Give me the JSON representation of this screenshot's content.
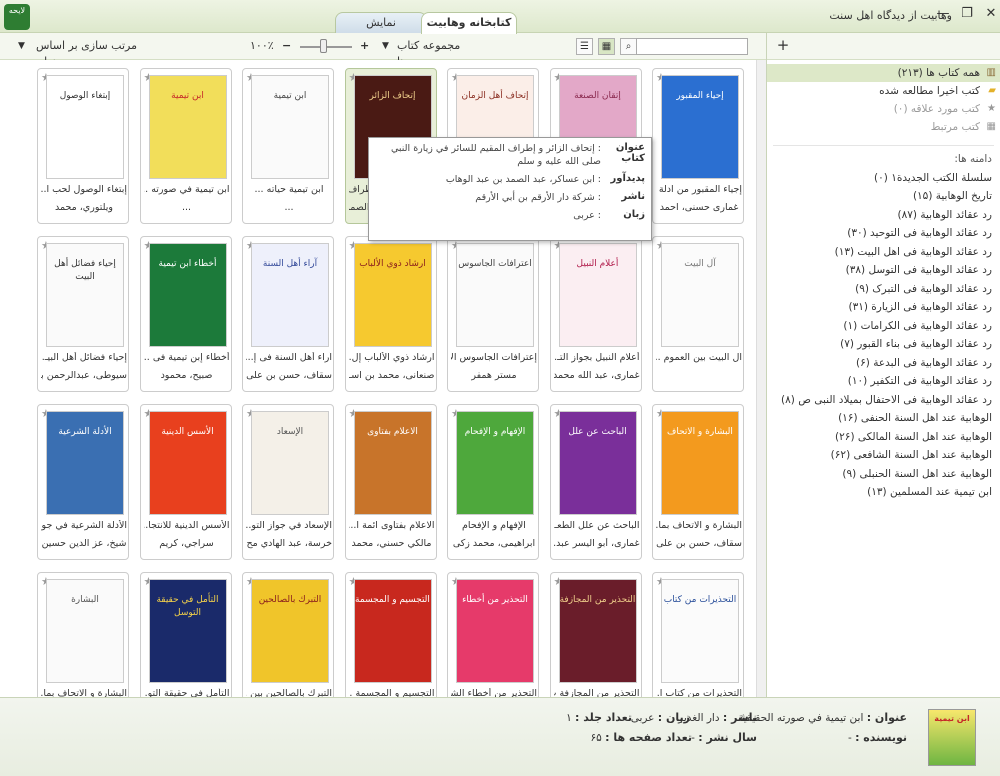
{
  "window": {
    "title": "وهابيت از ديدگاه اهل سنت",
    "logo_text": "لايحه",
    "close": "✕",
    "restore": "❐",
    "minimize": "—"
  },
  "tabs": [
    {
      "label": "کتابخانه وهابيت"
    },
    {
      "label": "نمايش"
    }
  ],
  "toolbar": {
    "collection_label": "مجموعه کتاب ها",
    "zoom": "۱۰۰٪",
    "zoom_minus": "−",
    "zoom_plus": "+",
    "sort_label": "مرتب سازی بر اساس زبان",
    "search_value": ""
  },
  "books": [
    {
      "title": "إجياء المقبور من ادلة ...",
      "author": "غماری حسنی، احمد",
      "cover": "إحياء المقبور",
      "bg": "#2b6fd1",
      "fg": "#fff"
    },
    {
      "title": "اتقان الصنعة في تحقي...",
      "author": "غماری، عبد الله محمد...",
      "cover": "إتقان الصنعة",
      "bg": "#e3a8c8",
      "fg": "#8b2b50"
    },
    {
      "title": "إتحاف أهل الزمان بأ...",
      "author": "ابن‌ابی‌ضیاف، احمد",
      "cover": "إتحاف أهل الزمان",
      "bg": "#fbeee8",
      "fg": "#8a2e22"
    },
    {
      "title": "إتحاف الزائر و إطراف...",
      "author": "ابن عساكر، عبد الصمد...",
      "cover": "إتحاف الزائر",
      "bg": "#4a1a14",
      "fg": "#f0d08c"
    },
    {
      "title": "ابن تيمية حياته ...",
      "author": "...",
      "cover": "ابن تيمية",
      "bg": "#fafafa",
      "fg": "#444"
    },
    {
      "title": "ابن تيمية في صورته ...",
      "author": "...",
      "cover": "ابن تيمية",
      "bg": "#f2de5a",
      "fg": "#c62828"
    },
    {
      "title": "إبتغاء الوصول لحب ا...",
      "author": "ويلتوري، محمد",
      "cover": "إبتغاء الوصول",
      "bg": "#fff",
      "fg": "#333"
    },
    {
      "title": "آل البيت بين العموم ...",
      "author": "",
      "cover": "آل البيت",
      "bg": "#fbfbfb",
      "fg": "#777"
    },
    {
      "title": "أعلام النبيل بجواز التـ...",
      "author": "غماری، عبد الله محمد...",
      "cover": "أعلام النبيل",
      "bg": "#fbeef2",
      "fg": "#b01a4a"
    },
    {
      "title": "إعترافات الجاسوس الا...",
      "author": "مستر همفر",
      "cover": "اعترافات الجاسوس",
      "bg": "#fafafa",
      "fg": "#444"
    },
    {
      "title": "ارشاد ذوي الألباب إل...",
      "author": "صنعانی، محمد بن اسـ...",
      "cover": "ارشاد ذوي الألباب",
      "bg": "#f6c92f",
      "fg": "#8a1d1d"
    },
    {
      "title": "آراء أهل السنة فى إ...",
      "author": "سقاف، حسن بن علی",
      "cover": "آراء أهل السنة",
      "bg": "#eef0fb",
      "fg": "#344a9a"
    },
    {
      "title": "أخطاء إبن تيمية فى ...",
      "author": "صبيح، محمود",
      "cover": "أخطاء ابن تيمية",
      "bg": "#1c7a3a",
      "fg": "#fff"
    },
    {
      "title": "إحياء فضائل أهل البيـ...",
      "author": "سيوطی، عبدالرحمن بـ...",
      "cover": "إحياء فضائل أهل البيت",
      "bg": "#fafafa",
      "fg": "#333"
    },
    {
      "title": "البشارة و الاتحاف بما...",
      "author": "سقاف، حسن بن علی",
      "cover": "البشارة و الاتحاف",
      "bg": "#f39a1e",
      "fg": "#fff"
    },
    {
      "title": "الباحث عن علل الطعـ...",
      "author": "غماری، أبو اليسر عبد...",
      "cover": "الباحث عن علل",
      "bg": "#7a2f9a",
      "fg": "#fff"
    },
    {
      "title": "الإفهام و الإفحام",
      "author": "ابراهیمی، محمد زکی",
      "cover": "الإفهام و الإفحام",
      "bg": "#4ea83c",
      "fg": "#fff"
    },
    {
      "title": "الاعلام بفتاوى ائمة ا...",
      "author": "مالكي حسني، محمد",
      "cover": "الاعلام بفتاوى",
      "bg": "#c8742a",
      "fg": "#fff"
    },
    {
      "title": "الإسعاد في جواز التو...",
      "author": "خرسة، عبد الهادي مح...",
      "cover": "الإسعاد",
      "bg": "#f4f0e8",
      "fg": "#555"
    },
    {
      "title": "الأسس الدينية للانتجا...",
      "author": "سراجي، کريم",
      "cover": "الأسس الدينية",
      "bg": "#e8401e",
      "fg": "#fff"
    },
    {
      "title": "الأدلة الشرعية في جوا...",
      "author": "شيخ، عز الدين حسين",
      "cover": "الأدلة الشرعية",
      "bg": "#3a6fb2",
      "fg": "#fff"
    },
    {
      "title": "التحذيرات من كتاب ا...",
      "author": "",
      "cover": "التحذيرات من كتاب",
      "bg": "#fbfbfb",
      "fg": "#2a4f9a"
    },
    {
      "title": "التحذير من المجازفة ب...",
      "author": "",
      "cover": "التحذير من المجازفة",
      "bg": "#6a1d2a",
      "fg": "#f0d08c"
    },
    {
      "title": "التحذير من أخطاء الشـ...",
      "author": "",
      "cover": "التحذير من أخطاء",
      "bg": "#e63a6a",
      "fg": "#fff"
    },
    {
      "title": "التجسيم و المجسمة ...",
      "author": "",
      "cover": "التجسيم و المجسمة",
      "bg": "#c8281e",
      "fg": "#fff"
    },
    {
      "title": "التبرك بالصالحين بين ...",
      "author": "",
      "cover": "التبرك بالصالحين",
      "bg": "#f0c52a",
      "fg": "#8a1d1d"
    },
    {
      "title": "التأمل في حقيقة التو...",
      "author": "",
      "cover": "التأمل في حقيقة التوسل",
      "bg": "#1a2a6a",
      "fg": "#f6d34a"
    },
    {
      "title": "البشارة و الاتحاف بما...",
      "author": "",
      "cover": "البشارة",
      "bg": "#fafafa",
      "fg": "#555"
    }
  ],
  "tooltip": {
    "title_label": "عنوان كتاب",
    "title_value": ": إتحاف الزائر و إطراف المقيم للسائر في زيارة النبي صلى الله عليه و سلم",
    "author_label": "پديدآور",
    "author_value": ": ابن عساكر، عبد الصمد بن عبد الوهاب",
    "publisher_label": "ناشر",
    "publisher_value": ": شركة دار الأرقم بن أبي الأرقم",
    "lang_label": "زبان",
    "lang_value": ": عربی"
  },
  "sidebar": {
    "add": "+",
    "items": [
      {
        "label": "همه کتاب ها (۲۱۳)",
        "icon": "books-icon"
      },
      {
        "label": "کتب اخیرا مطالعه شده",
        "icon": "folder-icon"
      },
      {
        "label": "کتب مورد علاقه (۰)",
        "icon": "star-icon"
      },
      {
        "label": "کتب مرتبط",
        "icon": "grid-icon"
      }
    ],
    "shelves_header": "دامنه ها:",
    "shelves": [
      "سلسلة الكتب الجديدة۱ (۰)",
      "تاریخ الوهابیة (۱۵)",
      "رد عقائد الوهابیة (۸۷)",
      "رد عقائد الوهابیة فی التوحید (۳۰)",
      "رد عقائد الوهابیة فی اهل البیت (۱۳)",
      "رد عقائد الوهابیة فی التوسل (۳۸)",
      "رد عقائد الوهابیة فی التبرک (۹)",
      "رد عقائد الوهابیة فی الزیارة (۳۱)",
      "رد عقائد الوهابیة فی الکرامات (۱)",
      "رد عقائد الوهابیة فی بناء القبور (۷)",
      "رد عقائد الوهابیة فی البدعة (۶)",
      "رد عقائد الوهابیة فی التکفیر (۱۰)",
      "رد عقائد الوهابیة فی الاحتفال بمیلاد النبی ص (۸)",
      "الوهابیة عند اهل السنة الحنفی (۱۶)",
      "الوهابیة عند اهل السنة المالکی (۲۶)",
      "الوهابیة عند اهل السنة الشافعی (۶۲)",
      "الوهابیة عند اهل السنة الحنبلی (۹)",
      "ابن تیمیة عند المسلمین (۱۳)"
    ]
  },
  "details": {
    "cover_text": "ابن تيمية",
    "title_label": "عنوان :",
    "title_value": "ابن تيمية في صورته الحقيقية",
    "author_label": "نویسنده :",
    "author_value": "-",
    "publisher_label": "ناشر :",
    "publisher_value": "دار الغدير",
    "year_label": "سال نشر :",
    "year_value": "-",
    "lang_label": "زبان :",
    "lang_value": "عربی",
    "pages_label": "تعداد صفحه ها :",
    "pages_value": "۶۵",
    "volumes_label": "تعداد جلد :",
    "volumes_value": "۱"
  }
}
